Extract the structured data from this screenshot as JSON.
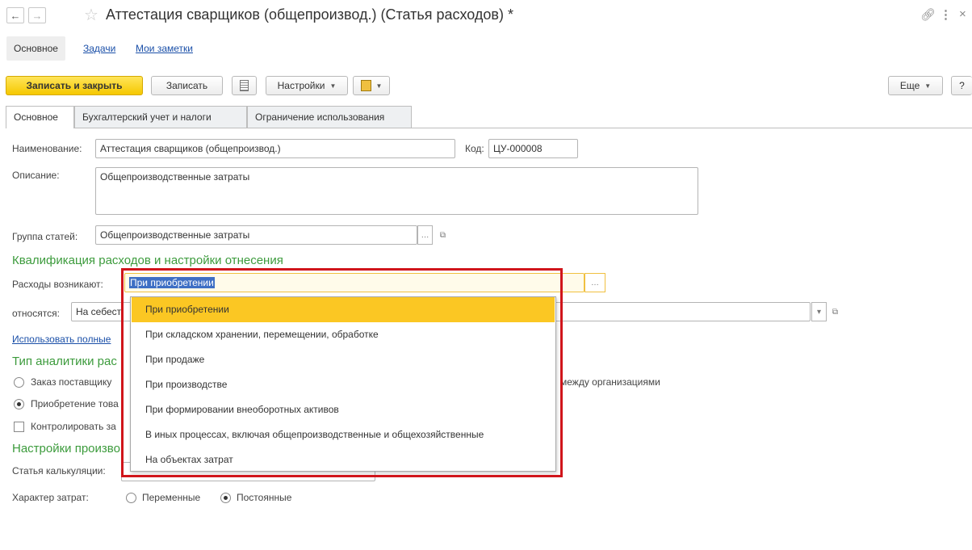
{
  "window": {
    "title": "Аттестация сварщиков (общепроизвод.) (Статья расходов) *"
  },
  "page_tabs": {
    "main": "Основное",
    "tasks": "Задачи",
    "notes": "Мои заметки"
  },
  "toolbar": {
    "save_close": "Записать и закрыть",
    "save": "Записать",
    "settings": "Настройки",
    "more": "Еще",
    "help": "?"
  },
  "form_tabs": [
    "Основное",
    "Бухгалтерский учет и налоги",
    "Ограничение использования"
  ],
  "fields": {
    "name_label": "Наименование:",
    "name_value": "Аттестация сварщиков (общепроизвод.)",
    "code_label": "Код:",
    "code_value": "ЦУ-000008",
    "description_label": "Описание:",
    "description_value": "Общепроизводственные затраты",
    "group_label": "Группа статей:",
    "group_value": "Общепроизводственные затраты"
  },
  "qualification": {
    "title": "Квалификация расходов и настройки отнесения",
    "arise_label": "Расходы возникают:",
    "arise_value": "При приобретении",
    "relate_label": "относятся:",
    "relate_value": "На себест",
    "use_full_link": "Использовать полные"
  },
  "analytics": {
    "title": "Тип аналитики рас",
    "option1": "Заказ поставщику",
    "option1_tail": "между организациями",
    "option2": "Приобретение това",
    "control": "Контролировать за"
  },
  "production": {
    "title": "Настройки произво",
    "calc_label": "Статья калькуляции:",
    "cost_nature_label": "Характер затрат:",
    "variable": "Переменные",
    "constant": "Постоянные"
  },
  "dropdown": {
    "items": [
      "При приобретении",
      "При складском хранении, перемещении, обработке",
      "При продаже",
      "При производстве",
      "При формировании внеоборотных активов",
      "В иных процессах, включая общепроизводственные и общехозяйственные",
      "На объектах затрат"
    ],
    "selected_index": 0
  },
  "icons": {
    "back": "arrow-left-icon",
    "forward": "arrow-right-icon",
    "favorite": "star-icon",
    "link": "link-icon",
    "menu": "more-vertical-icon",
    "close": "close-icon"
  },
  "colors": {
    "accent_yellow": "#f5c800",
    "section_green": "#3c9b3c",
    "link_blue": "#1a4fa8",
    "highlight_red": "#d0151b"
  }
}
